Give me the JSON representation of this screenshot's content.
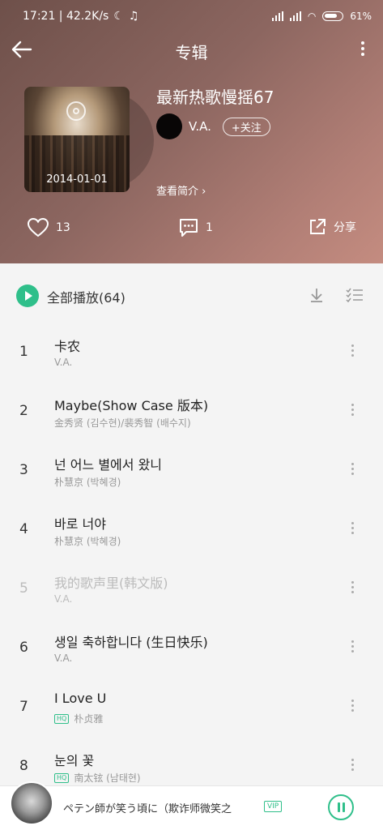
{
  "status": {
    "time_speed": "17:21 | 42.2K/s",
    "battery": "61%"
  },
  "topbar": {
    "title": "专辑"
  },
  "album": {
    "date": "2014-01-01",
    "title": "最新热歌慢摇67",
    "artist": "V.A.",
    "follow_label": "+关注",
    "intro_label": "查看简介 ›"
  },
  "actions": {
    "likes": "13",
    "comments": "1",
    "share_label": "分享"
  },
  "list": {
    "play_all_label": "全部播放(64)",
    "tracks": [
      {
        "num": "1",
        "title": "卡农",
        "artist": "V.A.",
        "hq": false,
        "disabled": false
      },
      {
        "num": "2",
        "title": "Maybe(Show Case 版本)",
        "artist": "金秀贤 (김수현)/裴秀智 (배수지)",
        "hq": false,
        "disabled": false
      },
      {
        "num": "3",
        "title": "넌 어느 별에서 왔니",
        "artist": "朴慧京 (박혜경)",
        "hq": false,
        "disabled": false
      },
      {
        "num": "4",
        "title": "바로 너야",
        "artist": "朴慧京 (박혜경)",
        "hq": false,
        "disabled": false
      },
      {
        "num": "5",
        "title": "我的歌声里(韩文版)",
        "artist": "V.A.",
        "hq": false,
        "disabled": true
      },
      {
        "num": "6",
        "title": "생일 축하합니다 (生日快乐)",
        "artist": "V.A.",
        "hq": false,
        "disabled": false
      },
      {
        "num": "7",
        "title": "I Love U",
        "artist": "朴贞雅",
        "hq": true,
        "disabled": false
      },
      {
        "num": "8",
        "title": "눈의 꽃",
        "artist": "南太铉 (남태현)",
        "hq": true,
        "disabled": false
      }
    ],
    "hq_label": "HQ"
  },
  "player": {
    "title": "ペテン師が笑う頃に（欺诈师微笑之",
    "vip_label": "VIP"
  },
  "colors": {
    "accent": "#2fbf8a",
    "header_start": "#6e504a",
    "header_end": "#c48c80"
  }
}
